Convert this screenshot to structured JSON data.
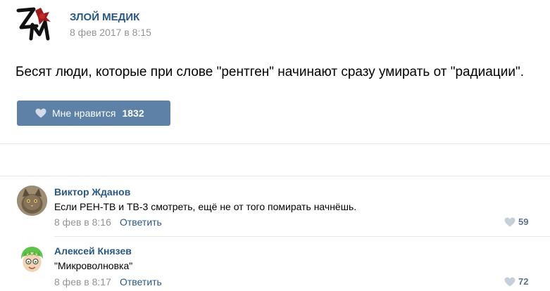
{
  "post": {
    "author": "ЗЛОЙ МЕДИК",
    "date": "8 фев 2017 в 8:15",
    "text": "Бесят люди, которые при слове \"рентген\" начинают сразу умирать от \"радиации\".",
    "like_label": "Мне нравится",
    "like_count": "1832"
  },
  "comments": [
    {
      "author": "Виктор Жданов",
      "text": "Если РЕН-ТВ и ТВ-3 смотреть, ещё не от того помирать начнёшь.",
      "date": "8 фев в 8:16",
      "reply_label": "Ответить",
      "likes": "59"
    },
    {
      "author": "Алексей Князев",
      "text": "\"Микроволновка\"",
      "date": "8 фев в 8:17",
      "reply_label": "Ответить",
      "likes": "72"
    }
  ],
  "colors": {
    "link": "#2a5885",
    "button": "#5e81a8",
    "muted": "#939393",
    "divider": "#e7e8ec"
  },
  "icons": [
    "community-logo",
    "heart-icon",
    "avatar-cat",
    "avatar-cartoon"
  ]
}
